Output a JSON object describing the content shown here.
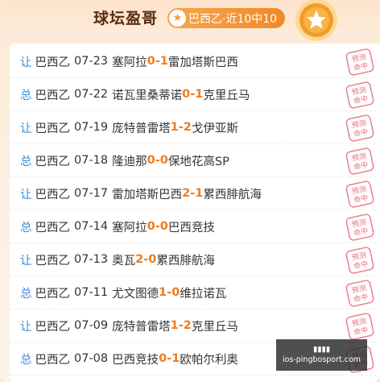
{
  "header": {
    "title": "球坛盈哥",
    "tag_label": "巴西乙·近10中10",
    "tag_icon": "star-icon",
    "medal_icon": "star-medal-icon"
  },
  "stamp_text": [
    "预测",
    "命中"
  ],
  "matches": [
    {
      "kind": "让",
      "league": "巴西乙",
      "date": "07-23",
      "home": "塞阿拉",
      "home_score": "0",
      "sep": " - ",
      "away_score": "1",
      "away": "雷加塔斯巴西"
    },
    {
      "kind": "总",
      "league": "巴西乙",
      "date": "07-22",
      "home": "诺瓦里桑蒂诺",
      "home_score": "0",
      "sep": " - ",
      "away_score": "1",
      "away": "克里丘马"
    },
    {
      "kind": "让",
      "league": "巴西乙",
      "date": "07-19",
      "home": "庞特普雷塔",
      "home_score": "1",
      "sep": " - ",
      "away_score": "2",
      "away": "戈伊亚斯"
    },
    {
      "kind": "总",
      "league": "巴西乙",
      "date": "07-18",
      "home": "隆迪那",
      "home_score": "0",
      "sep": " - ",
      "away_score": "0",
      "away": "保地花高SP"
    },
    {
      "kind": "让",
      "league": "巴西乙",
      "date": "07-17",
      "home": "雷加塔斯巴西",
      "home_score": "2",
      "sep": " - ",
      "away_score": "1",
      "away": "累西腓航海"
    },
    {
      "kind": "总",
      "league": "巴西乙",
      "date": "07-14",
      "home": "塞阿拉",
      "home_score": "0",
      "sep": " - ",
      "away_score": "0",
      "away": "巴西竞技"
    },
    {
      "kind": "让",
      "league": "巴西乙",
      "date": "07-13",
      "home": "奥瓦",
      "home_score": "2",
      "sep": " - ",
      "away_score": "0",
      "away": "累西腓航海"
    },
    {
      "kind": "总",
      "league": "巴西乙",
      "date": "07-11",
      "home": "尤文图德",
      "home_score": "1",
      "sep": " - ",
      "away_score": "0",
      "away": "维拉诺瓦"
    },
    {
      "kind": "让",
      "league": "巴西乙",
      "date": "07-09",
      "home": "庞特普雷塔",
      "home_score": "1",
      "sep": " - ",
      "away_score": "2",
      "away": "克里丘马"
    },
    {
      "kind": "总",
      "league": "巴西乙",
      "date": "07-08",
      "home": "巴西竞技",
      "home_score": "0",
      "sep": " - ",
      "away_score": "1",
      "away": "欧帕尔利奥"
    }
  ],
  "watermark": {
    "line1": "▮▮▮▮",
    "line2": "ios-pingbosport.com"
  },
  "colors": {
    "accent": "#f07c1c",
    "kind": "#3e8fd6",
    "title": "#5a2e12",
    "stamp": "#e4576a"
  }
}
